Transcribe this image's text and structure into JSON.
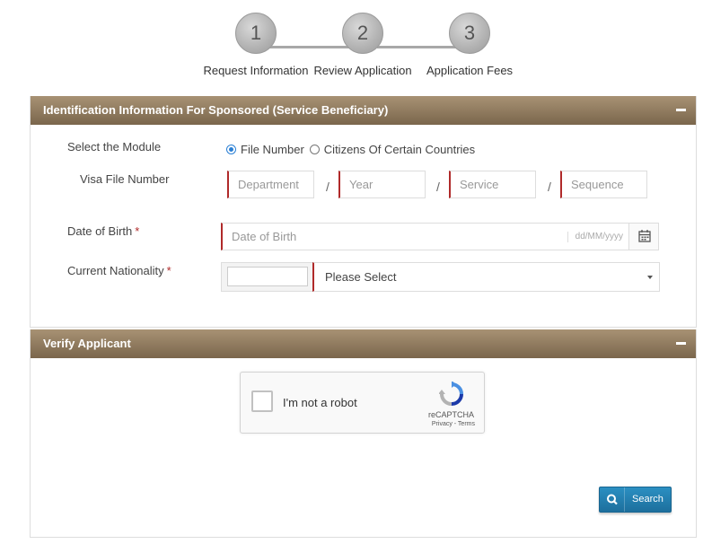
{
  "stepper": {
    "steps": [
      {
        "number": "1",
        "label": "Request Information"
      },
      {
        "number": "2",
        "label": "Review Application"
      },
      {
        "number": "3",
        "label": "Application Fees"
      }
    ]
  },
  "identification_panel": {
    "title": "Identification Information For Sponsored (Service Beneficiary)",
    "select_module_label": "Select the Module",
    "module_options": [
      {
        "label": "File Number",
        "selected": true
      },
      {
        "label": "Citizens Of Certain Countries",
        "selected": false
      }
    ],
    "visa_file_label": "Visa File Number",
    "visa_fields": [
      {
        "placeholder": "Department"
      },
      {
        "placeholder": "Year"
      },
      {
        "placeholder": "Service"
      },
      {
        "placeholder": "Sequence"
      }
    ],
    "separator": "/",
    "dob_label": "Date of Birth",
    "dob_placeholder": "Date of Birth",
    "dob_format_hint": "dd/MM/yyyy",
    "nationality_label": "Current Nationality",
    "nationality_value": "Please Select",
    "required_marker": "*"
  },
  "verify_panel": {
    "title": "Verify Applicant",
    "captcha_text": "I'm not a robot",
    "captcha_brand": "reCAPTCHA",
    "captcha_links": "Privacy - Terms",
    "search_label": "Search"
  },
  "colors": {
    "header_gradient_top": "#a89274",
    "header_gradient_bottom": "#7a664c",
    "required_accent": "#b02a2a",
    "button_blue": "#1d6f9d"
  }
}
